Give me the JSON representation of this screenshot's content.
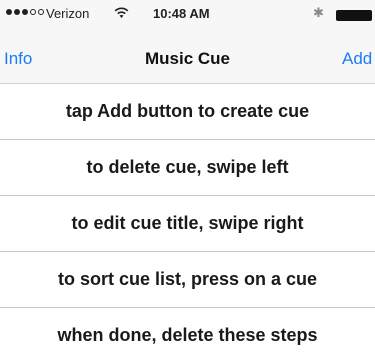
{
  "status_bar": {
    "carrier": "Verizon",
    "time": "10:48 AM",
    "bluetooth_symbol": "✱",
    "signal_strength": 3,
    "signal_max": 5
  },
  "nav_bar": {
    "left_button": "Info",
    "title": "Music Cue",
    "right_button": "Add",
    "accent_color": "#1b7cf4"
  },
  "cue_list": {
    "items": [
      {
        "label": "tap Add button to create cue"
      },
      {
        "label": "to delete cue, swipe left"
      },
      {
        "label": "to edit cue title, swipe right"
      },
      {
        "label": "to sort cue list, press on a cue"
      },
      {
        "label": "when done, delete these steps"
      }
    ]
  }
}
